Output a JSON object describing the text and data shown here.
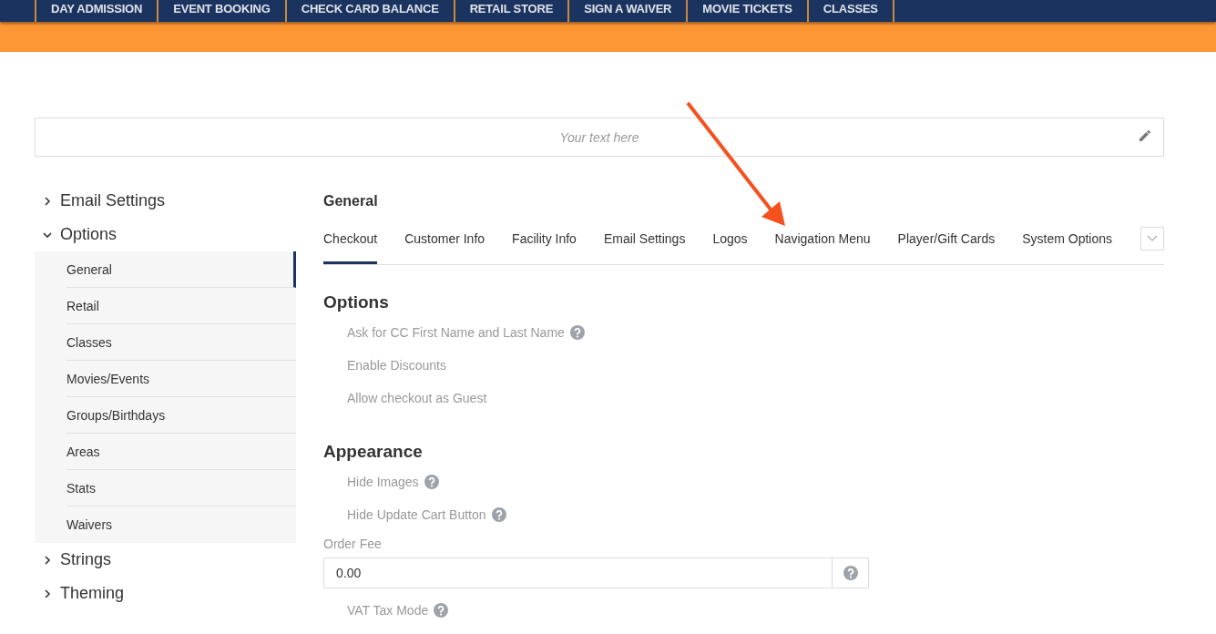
{
  "top_nav": [
    {
      "label": "DAY ADMISSION"
    },
    {
      "label": "EVENT BOOKING"
    },
    {
      "label": "CHECK CARD BALANCE"
    },
    {
      "label": "RETAIL STORE"
    },
    {
      "label": "SIGN A WAIVER"
    },
    {
      "label": "MOVIE TICKETS"
    },
    {
      "label": "CLASSES"
    }
  ],
  "banner": {
    "placeholder": "Your text here"
  },
  "sidebar": {
    "items": [
      {
        "label": "Email Settings",
        "expanded": false
      },
      {
        "label": "Options",
        "expanded": true,
        "children": [
          {
            "label": "General",
            "selected": true
          },
          {
            "label": "Retail",
            "selected": false
          },
          {
            "label": "Classes",
            "selected": false
          },
          {
            "label": "Movies/Events",
            "selected": false
          },
          {
            "label": "Groups/Birthdays",
            "selected": false
          },
          {
            "label": "Areas",
            "selected": false
          },
          {
            "label": "Stats",
            "selected": false
          },
          {
            "label": "Waivers",
            "selected": false
          }
        ]
      },
      {
        "label": "Strings",
        "expanded": false
      },
      {
        "label": "Theming",
        "expanded": false
      }
    ]
  },
  "content": {
    "title": "General",
    "tabs": [
      {
        "label": "Checkout",
        "selected": true
      },
      {
        "label": "Customer Info",
        "selected": false
      },
      {
        "label": "Facility Info",
        "selected": false
      },
      {
        "label": "Email Settings",
        "selected": false
      },
      {
        "label": "Logos",
        "selected": false
      },
      {
        "label": "Navigation Menu",
        "selected": false
      },
      {
        "label": "Player/Gift Cards",
        "selected": false
      },
      {
        "label": "System Options",
        "selected": false
      }
    ],
    "sections": [
      {
        "kind": "heading",
        "label": "Options"
      },
      {
        "kind": "option",
        "label": "Ask for CC First Name and Last Name",
        "help": true
      },
      {
        "kind": "option",
        "label": "Enable Discounts",
        "help": false
      },
      {
        "kind": "option",
        "label": "Allow checkout as Guest",
        "help": false
      },
      {
        "kind": "heading",
        "label": "Appearance"
      },
      {
        "kind": "option",
        "label": "Hide Images",
        "help": true
      },
      {
        "kind": "option",
        "label": "Hide Update Cart Button",
        "help": true
      },
      {
        "kind": "field",
        "label": "Order Fee",
        "value": "0.00",
        "help": true
      },
      {
        "kind": "option",
        "label": "VAT Tax Mode",
        "help": true
      }
    ]
  }
}
